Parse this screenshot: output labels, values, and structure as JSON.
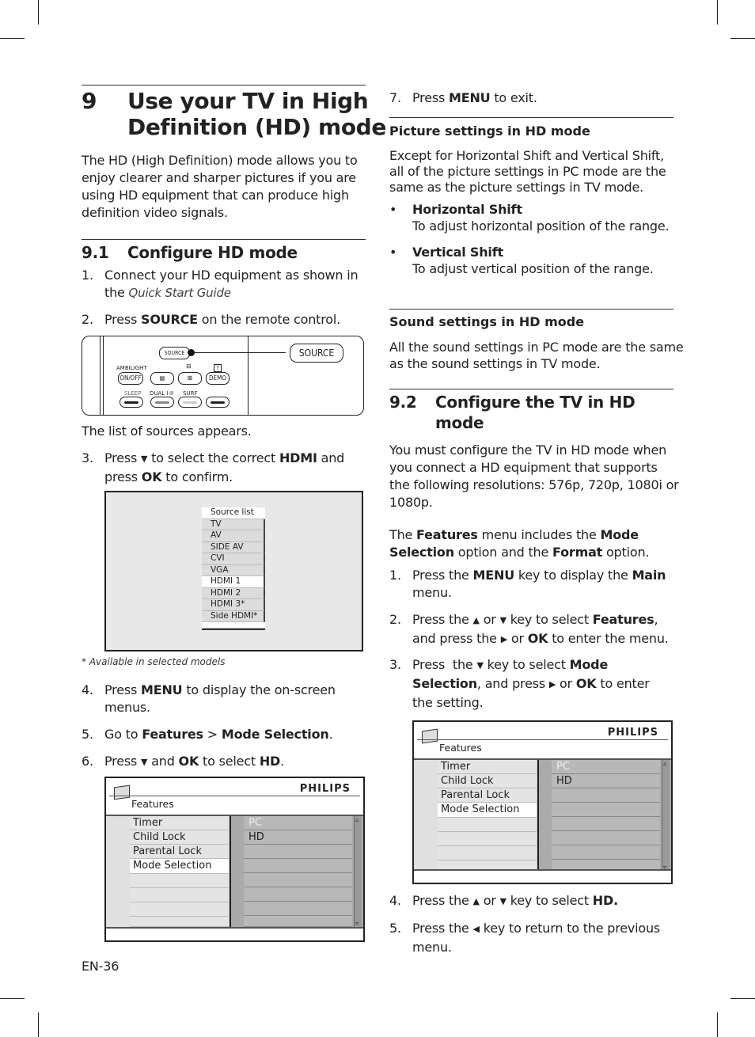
{
  "page_number": "EN-36",
  "chapter": {
    "number": "9",
    "title_line1": "Use your TV in High",
    "title_line2": "Definition (HD) mode",
    "intro": [
      "The HD (High Definition) mode allows you to",
      "enjoy clearer and sharper pictures if you are",
      "using HD equipment that can produce high",
      "definition video signals."
    ]
  },
  "section_9_1": {
    "number": "9.1",
    "title": "Configure HD mode",
    "steps": {
      "s1": {
        "n": "1.",
        "a": "Connect your HD equipment as shown in",
        "b_pre": "the ",
        "b_italic": "Quick Start Guide"
      },
      "s2": {
        "n": "2.",
        "pre": "Press ",
        "bold": "SOURCE",
        "post": " on the remote control."
      },
      "after_remote": "The list of sources appears.",
      "s3": {
        "n": "3.",
        "pre": "Press ",
        "arrow": "▼",
        "mid": " to select the correct ",
        "bold": "HDMI",
        "post": " and",
        "l2_pre": "press ",
        "l2_bold": "OK",
        "l2_post": " to confirm."
      },
      "footnote": "* Available in selected models",
      "s4": {
        "n": "4.",
        "pre": "Press ",
        "bold": "MENU",
        "post": " to display the on-screen",
        "l2": "menus."
      },
      "s5": {
        "n": "5.",
        "pre": "Go to ",
        "bold1": "Features",
        "mid": " > ",
        "bold2": "Mode Selection",
        "post": "."
      },
      "s6": {
        "n": "6.",
        "pre": "Press ",
        "arrow": "▼",
        "mid1": " and ",
        "bold1": "OK",
        "mid2": " to select ",
        "bold2": "HD",
        "post": "."
      },
      "s7": {
        "n": "7.",
        "pre": "Press ",
        "bold": "MENU",
        "post": " to exit."
      }
    },
    "remote": {
      "source_button": "SOURCE",
      "callout_label": "SOURCE",
      "ambilight_label": "AMBILIGHT",
      "on_off": "ON/OFF",
      "demo": "DEMO",
      "sleep": "SLEEP",
      "dual": "DUAL I-II",
      "surf": "SURF",
      "help_icon": "?"
    },
    "source_list": {
      "header": "Source list",
      "items": [
        "TV",
        "AV",
        "SIDE AV",
        "CVI",
        "VGA",
        "HDMI 1",
        "HDMI 2",
        "HDMI 3*",
        "Side HDMI*"
      ],
      "selected": "HDMI 1"
    }
  },
  "features_menu": {
    "brand": "PHILIPS",
    "title": "Features",
    "left_items": [
      "Timer",
      "Child Lock",
      "Parental Lock",
      "Mode Selection"
    ],
    "selected": "Mode Selection",
    "right_items": [
      "PC",
      "HD"
    ],
    "scroll_up": "▵",
    "scroll_down": "▿"
  },
  "picture_settings": {
    "title": "Picture settings in HD mode",
    "body": [
      "Except for Horizontal Shift and Vertical Shift,",
      "all of the picture settings in PC mode are the",
      "same as the picture settings in TV mode."
    ],
    "bullets": [
      {
        "title": "Horizontal Shift",
        "desc": "To adjust horizontal position of the range."
      },
      {
        "title": "Vertical Shift",
        "desc": "To adjust vertical position of the range."
      }
    ]
  },
  "sound_settings": {
    "title": "Sound settings in HD mode",
    "body": [
      "All the sound settings in PC mode are the same",
      "as the sound settings in TV mode."
    ]
  },
  "section_9_2": {
    "number": "9.2",
    "title_line1": "Configure the TV in HD",
    "title_line2": "mode",
    "intro": [
      "You must configure the TV in HD mode when",
      "you connect a HD equipment that supports",
      "the following resolutions: 576p, 720p, 1080i or",
      "1080p."
    ],
    "features_line1_pre": "The ",
    "features_line1_b1": "Features",
    "features_line1_mid": " menu includes the ",
    "features_line1_b2": "Mode",
    "features_line2_b": "Selection",
    "features_line2_mid": " option and the ",
    "features_line2_b2": "Format",
    "features_line2_post": " option.",
    "steps": {
      "s1": {
        "n": "1.",
        "pre": "Press the ",
        "b1": "MENU",
        "mid": " key to display the ",
        "b2": "Main",
        "l2": "menu."
      },
      "s2": {
        "n": "2.",
        "pre": "Press the ",
        "up": "▲",
        "or": " or ",
        "down": "▼",
        "mid": " key to select ",
        "b": "Features",
        "post": ",",
        "l2_pre": "and press the ",
        "right": "▶",
        "l2_or": " or ",
        "l2_b": "OK",
        "l2_post": " to enter the menu."
      },
      "s3": {
        "n": "3.",
        "pre": "Press  the ",
        "down": "▼",
        "mid": " key to select ",
        "b": "Mode",
        "l2_b": "Selection",
        "l2_mid": ", and press ",
        "right": "▶",
        "l2_or": " or ",
        "l2_b2": "OK",
        "l2_post": " to enter",
        "l3": "the setting."
      },
      "s4": {
        "n": "4.",
        "pre": "Press the ",
        "up": "▲",
        "or": " or ",
        "down": "▼",
        "mid": " key to select ",
        "b": "HD."
      },
      "s5": {
        "n": "5.",
        "pre": "Press the ",
        "left": "◀",
        "mid": " key to return to the previous",
        "l2": "menu."
      }
    }
  }
}
